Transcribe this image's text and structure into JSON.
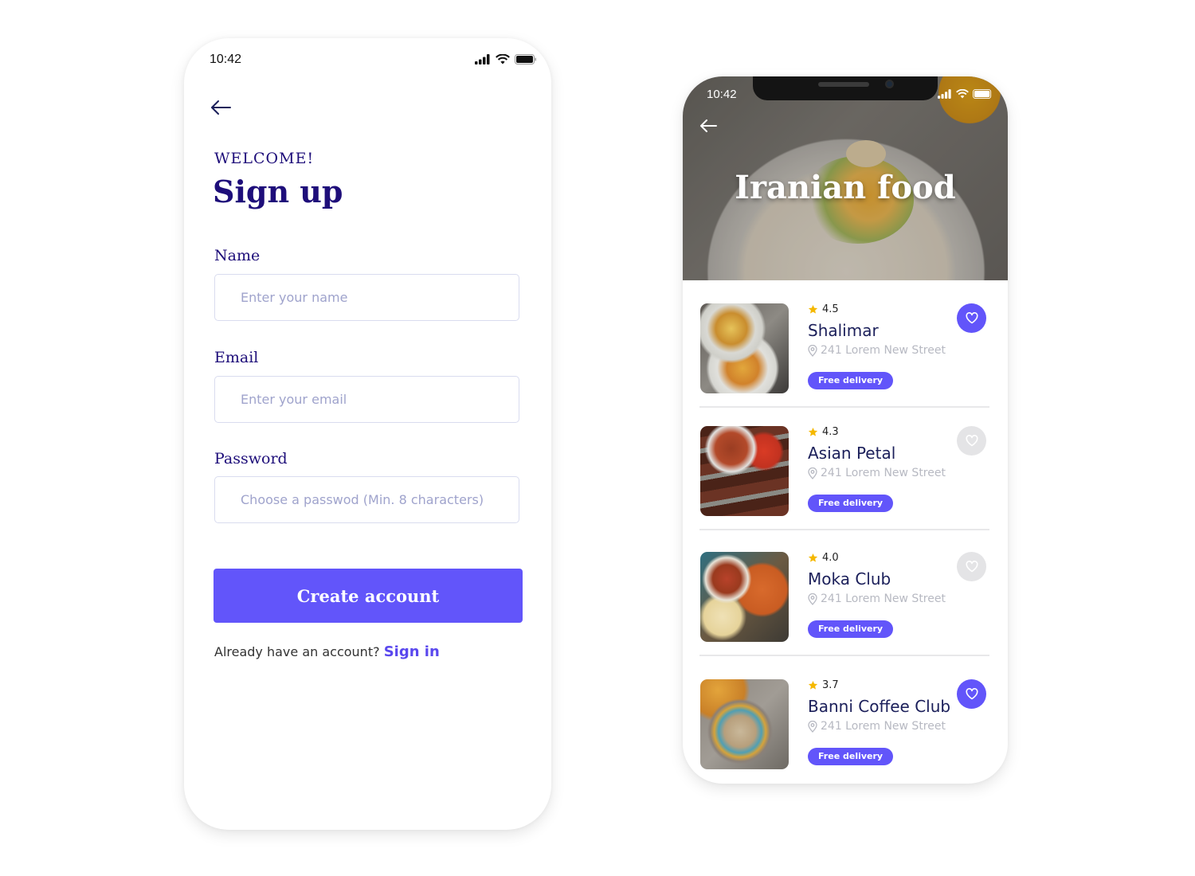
{
  "signup_screen": {
    "status_bar": {
      "time": "10:42"
    },
    "back_icon": "arrow-left-icon",
    "welcome": "WELCOME!",
    "title": "Sign up",
    "fields": [
      {
        "label": "Name",
        "placeholder": "Enter your name",
        "value": ""
      },
      {
        "label": "Email",
        "placeholder": "Enter your email",
        "value": ""
      },
      {
        "label": "Password",
        "placeholder": "Choose a passwod (Min. 8 characters)",
        "value": ""
      }
    ],
    "create_button": "Create account",
    "signin_prompt": "Already have an account?",
    "signin_link": "Sign in"
  },
  "food_screen": {
    "status_bar": {
      "time": "10:42"
    },
    "back_icon": "arrow-left-icon",
    "hero_title": "Iranian food",
    "restaurants": [
      {
        "name": "Shalimar",
        "rating": "4.5",
        "address": "241 Lorem New Street",
        "badge": "Free delivery",
        "favorite": true
      },
      {
        "name": "Asian Petal",
        "rating": "4.3",
        "address": "241 Lorem New Street",
        "badge": "Free delivery",
        "favorite": false
      },
      {
        "name": "Moka Club",
        "rating": "4.0",
        "address": "241 Lorem New Street",
        "badge": "Free delivery",
        "favorite": false
      },
      {
        "name": "Banni Coffee Club",
        "rating": "3.7",
        "address": "241 Lorem New Street",
        "badge": "Free delivery",
        "favorite": true
      }
    ]
  },
  "colors": {
    "accent": "#6255fa",
    "heading": "#1e0e7a",
    "restaurant_name": "#1b1f5a",
    "muted": "#b7b9c2",
    "star": "#f5b800",
    "fav_inactive": "#e4e4e6"
  }
}
